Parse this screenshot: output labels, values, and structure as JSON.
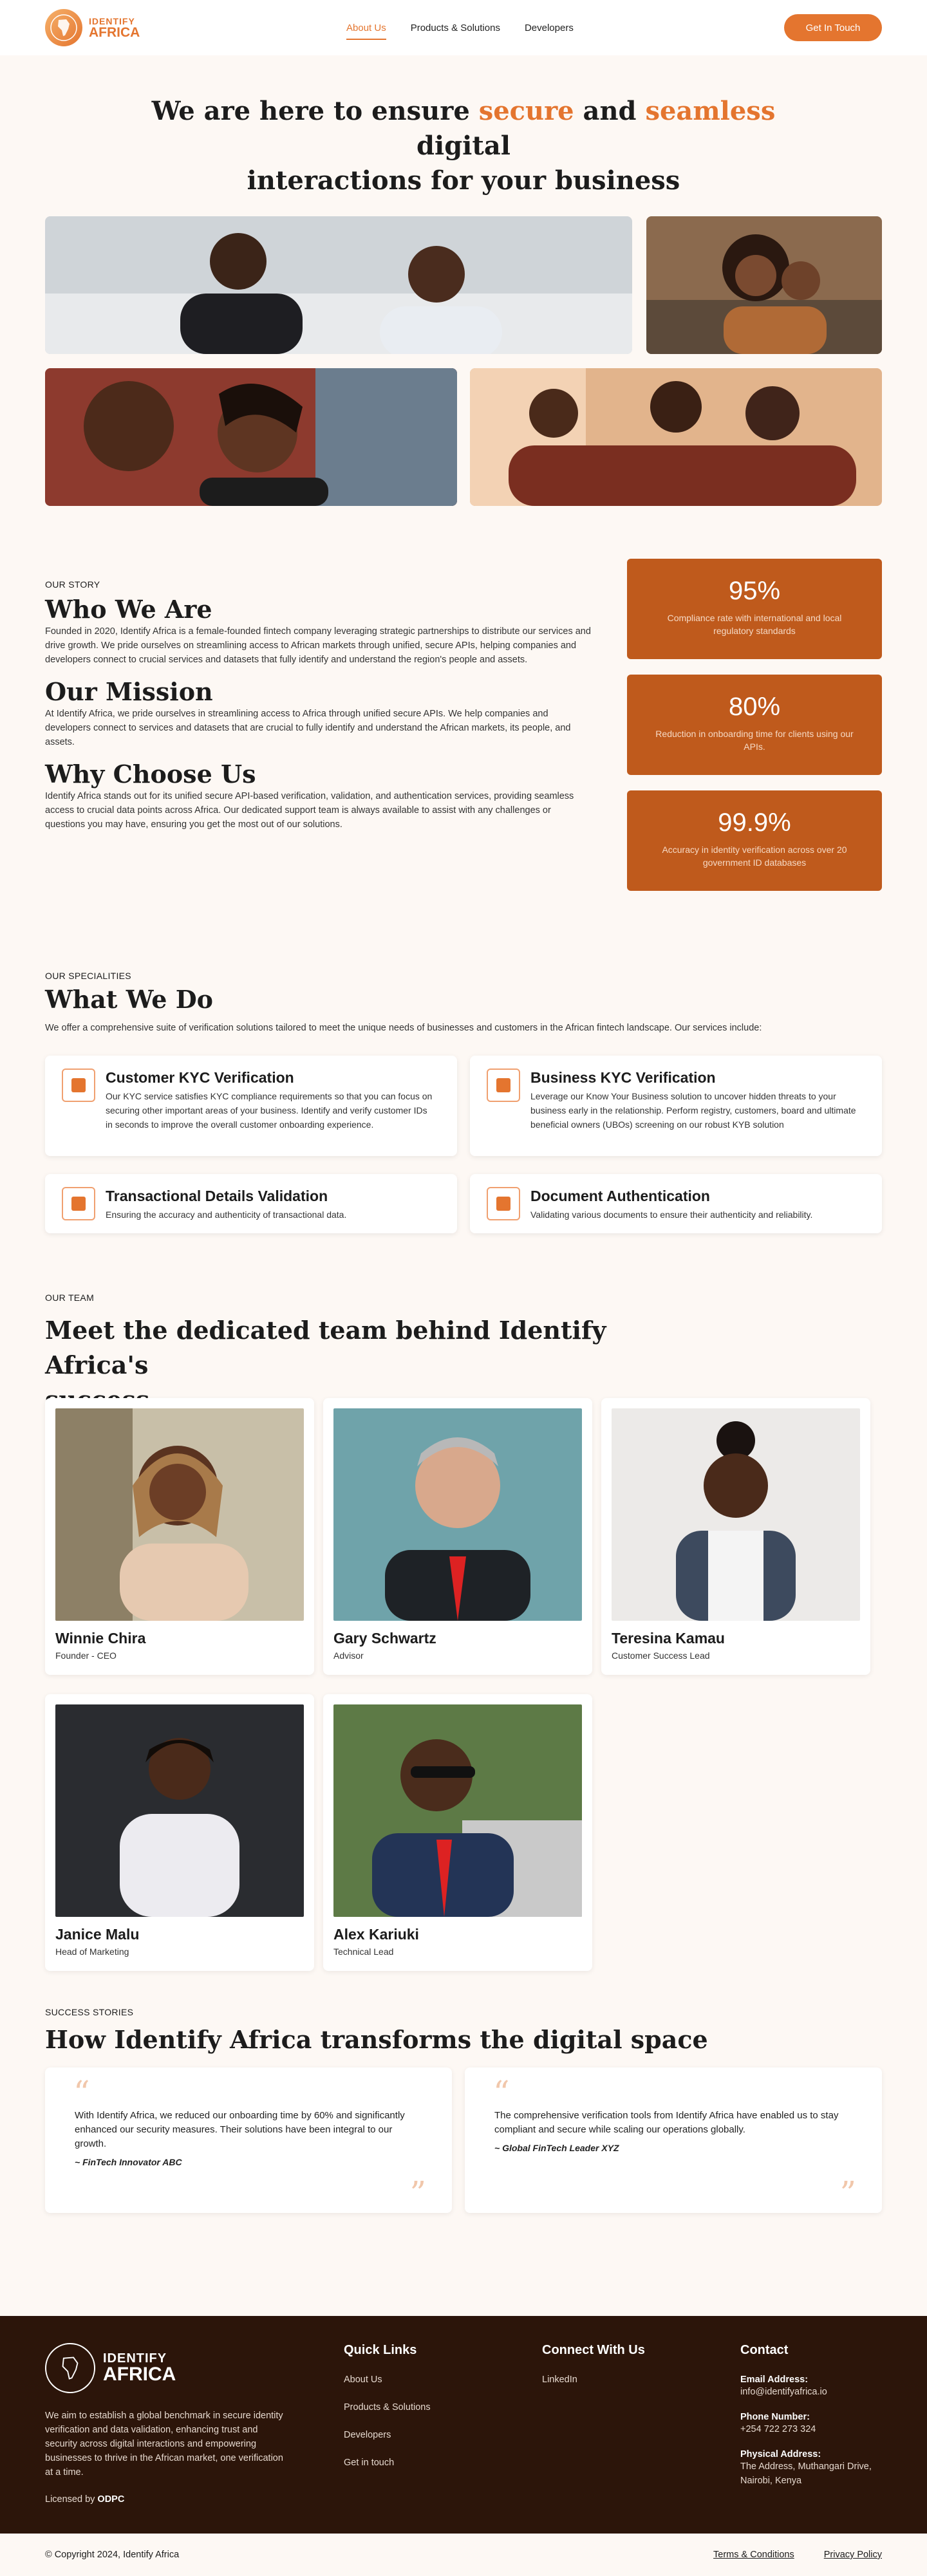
{
  "nav": {
    "brand_top": "IDENTIFY",
    "brand_bottom": "AFRICA",
    "links": [
      {
        "label": "About Us",
        "active": true
      },
      {
        "label": "Products & Solutions"
      },
      {
        "label": "Developers"
      }
    ],
    "cta": "Get In Touch"
  },
  "hero": {
    "t1": "We are here to ensure ",
    "t2": "secure",
    "t3": " and ",
    "t4": "seamless",
    "t5": " digital",
    "t6": "interactions for your business"
  },
  "story": {
    "eyebrow": "OUR STORY",
    "who_title": "Who We Are",
    "who_text": "Founded in 2020, Identify Africa is a female-founded fintech company leveraging strategic partnerships to distribute our services and drive growth. We pride ourselves on streamlining access to African markets through unified, secure APIs, helping companies and developers connect to crucial services and datasets that fully identify and understand the region's people and assets.",
    "mission_title": "Our Mission",
    "mission_text": "At Identify Africa, we pride ourselves in streamlining access to Africa through unified secure APIs. We help companies and developers connect to services and datasets that are crucial to fully identify and understand the African markets, its people, and assets.",
    "why_title": "Why Choose Us",
    "why_text": "Identify Africa stands out for its unified secure API-based verification, validation, and authentication services, providing seamless access to crucial data points across Africa. Our dedicated support team is always available to assist with any challenges or questions you may have, ensuring you get the most out of our solutions.",
    "stats": [
      {
        "value": "95%",
        "label": "Compliance rate with international and local regulatory standards"
      },
      {
        "value": "80%",
        "label": "Reduction in onboarding time for clients using our APIs."
      },
      {
        "value": "99.9%",
        "label": "Accuracy in identity verification across over 20 government ID databases"
      }
    ]
  },
  "spec": {
    "eyebrow": "OUR SPECIALITIES",
    "title": "What We Do",
    "intro": "We offer a comprehensive suite of verification solutions tailored to meet the unique needs of businesses and customers in the African fintech landscape. Our services include:",
    "cards": [
      {
        "title": "Customer KYC Verification",
        "desc": "Our KYC service satisfies KYC compliance requirements so that you can focus on securing other important areas of your business. Identify and verify customer IDs in seconds to improve the overall customer onboarding experience.",
        "icon": "user-id-icon"
      },
      {
        "title": "Business KYC Verification",
        "desc": "Leverage our Know Your Business solution to uncover hidden threats to your business early in the relationship. Perform registry, customers, board and ultimate beneficial owners (UBOs) screening on our robust KYB solution",
        "icon": "building-icon"
      },
      {
        "title": "Transactional Details Validation",
        "desc": "Ensuring the accuracy and authenticity of transactional data.",
        "icon": "wallet-icon"
      },
      {
        "title": "Document Authentication",
        "desc": "Validating various documents to ensure their authenticity and reliability.",
        "icon": "document-icon"
      }
    ]
  },
  "team": {
    "eyebrow": "OUR TEAM",
    "title1": "Meet the dedicated team behind Identify Africa's",
    "title2": "success",
    "members": [
      {
        "name": "Winnie Chira",
        "role": "Founder - CEO"
      },
      {
        "name": "Gary Schwartz",
        "role": "Advisor"
      },
      {
        "name": "Teresina Kamau",
        "role": "Customer Success Lead"
      },
      {
        "name": "Janice Malu",
        "role": "Head of Marketing"
      },
      {
        "name": "Alex Kariuki",
        "role": "Technical Lead"
      }
    ]
  },
  "stories": {
    "eyebrow": "SUCCESS STORIES",
    "title": "How Identify Africa transforms the digital space",
    "quotes": [
      {
        "text": "With Identify Africa, we reduced our onboarding time by 60% and significantly enhanced our security measures. Their solutions have been integral to our growth.",
        "author": "~ FinTech Innovator ABC"
      },
      {
        "text": "The comprehensive verification tools from Identify Africa have enabled us to stay compliant and secure while scaling our operations globally.",
        "author": "~ Global FinTech Leader XYZ"
      }
    ]
  },
  "footer": {
    "brand_top": "IDENTIFY",
    "brand_bottom": "AFRICA",
    "about": "We aim to establish a global benchmark in secure identity verification and data validation, enhancing trust and security across digital interactions and empowering businesses to thrive in the African market, one verification at a time.",
    "licensed_prefix": "Licensed by ",
    "licensed_by": "ODPC",
    "quick_title": "Quick Links",
    "quick": [
      "About Us",
      "Products & Solutions",
      "Developers",
      "Get in touch"
    ],
    "connect_title": "Connect With Us",
    "connect": [
      "LinkedIn"
    ],
    "contact_title": "Contact",
    "email_label": "Email Address:",
    "email": "info@identifyafrica.io",
    "phone_label": "Phone Number:",
    "phone": "+254 722 273 324",
    "address_label": "Physical Address:",
    "address": "The Address, Muthangari Drive, Nairobi, Kenya"
  },
  "bottom": {
    "copyright": "© Copyright 2024, Identify Africa",
    "terms": "Terms & Conditions",
    "privacy": "Privacy Policy"
  },
  "colors": {
    "accent": "#e4752f",
    "stat_bg": "#bf5a1c",
    "footer_bg": "#2c150a"
  }
}
